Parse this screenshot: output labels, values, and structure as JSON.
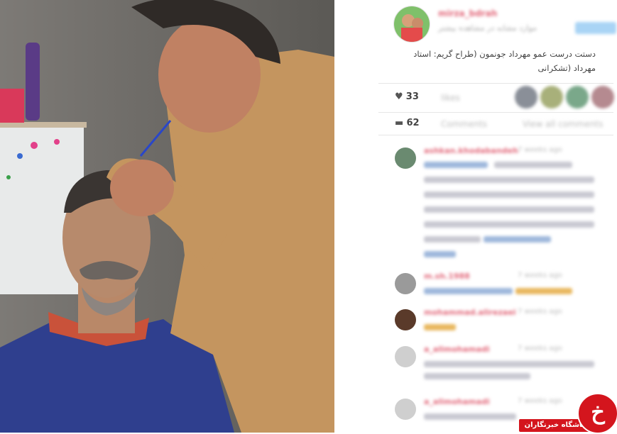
{
  "post": {
    "owner_username": "mirza_bdrah",
    "owner_subtitle": "موارد مشابه در مشاهده بیشتر",
    "caption": "دستت درست عمو مهرداد جونمون (طراح گریم: استاد مهرداد (تشکرانی",
    "likes_count": "33",
    "likes_label": "likes",
    "comments_count": "62",
    "comments_label": "Comments",
    "view_all_label": "View all comments"
  },
  "comments": [
    {
      "username": "ashkan.khodabandeh",
      "time": "7 weeks ago"
    },
    {
      "username": "m.sh.1988",
      "time": "7 weeks ago"
    },
    {
      "username": "mohammad.alirezaei",
      "time": "7 weeks ago"
    },
    {
      "username": "a_alimohamadi",
      "time": "7 weeks ago"
    },
    {
      "username": "a_alimohamadi",
      "time": "7 weeks ago"
    }
  ],
  "watermark": {
    "logo_glyph": "خ",
    "text": "باشگاه خبرنگاران"
  },
  "colors": {
    "username": "#e2687a",
    "follow_button": "#a9d4f5",
    "watermark_red": "#d4151d"
  },
  "icons": {
    "likes": "heart-icon",
    "comments": "comment-bubble-icon"
  }
}
